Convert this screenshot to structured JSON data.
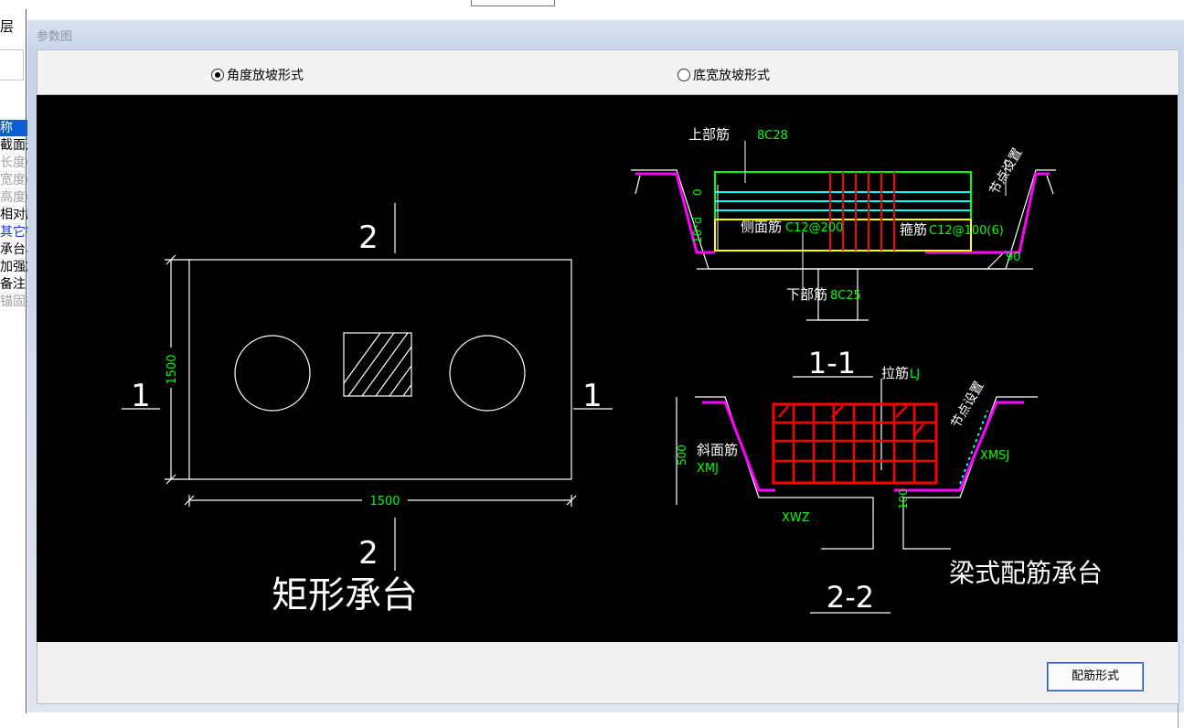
{
  "left_panel": {
    "title": "层",
    "list": [
      {
        "text": "称",
        "style": "sel"
      },
      {
        "text": "截面形",
        "style": ""
      },
      {
        "text": "长度(",
        "style": "gray"
      },
      {
        "text": "宽度(",
        "style": "gray"
      },
      {
        "text": "高度(",
        "style": "gray"
      },
      {
        "text": "相对底",
        "style": ""
      },
      {
        "text": "其它钢",
        "style": "blue"
      },
      {
        "text": "承台单",
        "style": ""
      },
      {
        "text": "加强筋",
        "style": ""
      },
      {
        "text": "备注",
        "style": ""
      },
      {
        "text": "锚固搭",
        "style": "gray"
      }
    ]
  },
  "dialog": {
    "title": "参数图",
    "radio_angle": "角度放坡形式",
    "radio_width": "底宽放坡形式",
    "button_rebar": "配筋形式"
  },
  "drawing": {
    "rect_title": "矩形承台",
    "beam_title": "梁式配筋承台",
    "dim_width": "1500",
    "dim_height": "1500",
    "section_2": "2",
    "section_1": "1",
    "section_11_title": "1-1",
    "section_22_title": "2-2",
    "top_rebar_label": "上部筋",
    "top_rebar_value": "8C28",
    "side_rebar_label": "侧面筋",
    "side_rebar_value": "C12@200",
    "stirrup_label": "箍筋",
    "stirrup_value": "C12@100(6)",
    "bottom_rebar_label": "下部筋",
    "bottom_rebar_value": "8C25",
    "node_setting_1": "节点设置",
    "node_setting_2": "节点设置",
    "angle_value": "90",
    "dim_0": "0",
    "dim_10d": "10*d",
    "tie_label": "拉筋",
    "tie_value": "LJ",
    "slope_label": "斜面筋",
    "slope_value": "XMJ",
    "xmsj": "XMSJ",
    "xwz": "XWZ",
    "dim_500": "500",
    "dim_100": "100"
  },
  "colors": {
    "green": "#00ff00",
    "magenta": "#ff00ff",
    "red": "#ff0000",
    "cyan": "#00ffff",
    "yellow": "#ffff00"
  }
}
